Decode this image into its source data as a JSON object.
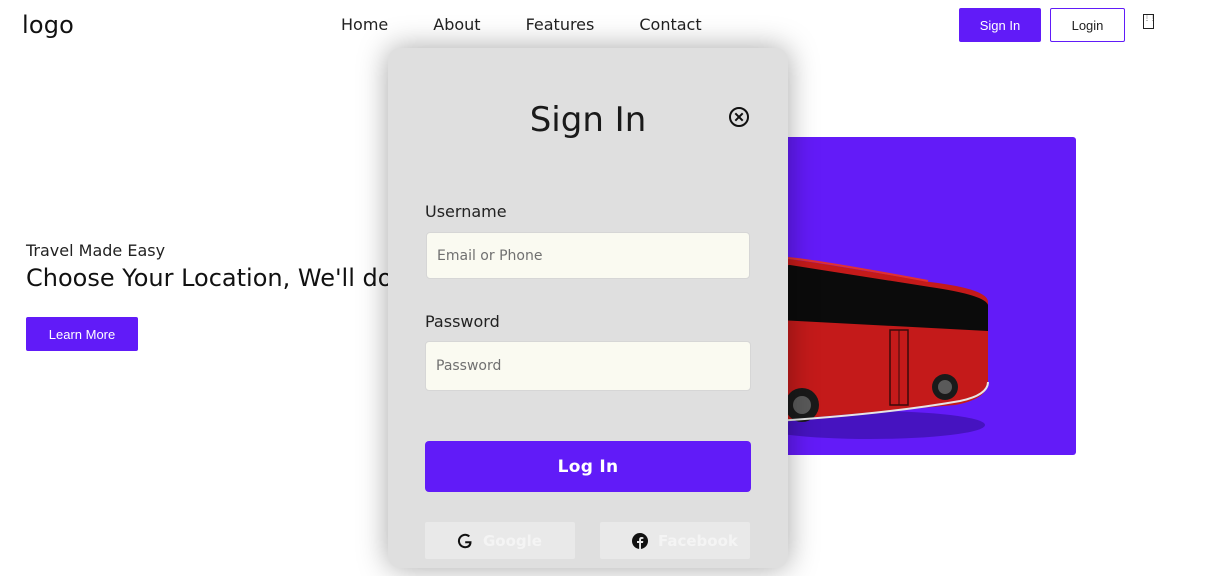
{
  "header": {
    "logo": "logo",
    "nav": [
      "Home",
      "About",
      "Features",
      "Contact"
    ],
    "sign_in_label": "Sign In",
    "login_label": "Login",
    "theme_icon_text": "⋮⋮"
  },
  "hero": {
    "subtitle": "Travel Made Easy",
    "title": "Choose Your Location, We'll do",
    "learn_more_label": "Learn More",
    "image_icon": "bus-illustration"
  },
  "modal": {
    "title": "Sign In",
    "close_icon": "close-circle-icon",
    "username_label": "Username",
    "username_placeholder": "Email or Phone",
    "password_label": "Password",
    "password_placeholder": "Password",
    "submit_label": "Log In",
    "social": [
      {
        "label": "Google",
        "icon": "google-icon"
      },
      {
        "label": "Facebook",
        "icon": "facebook-icon"
      }
    ]
  },
  "colors": {
    "accent": "#611bf8",
    "hero_panel": "#631bf8",
    "modal_bg": "#dfdfdf",
    "input_bg": "#fafaf1",
    "bus_red": "#c41a1a"
  }
}
